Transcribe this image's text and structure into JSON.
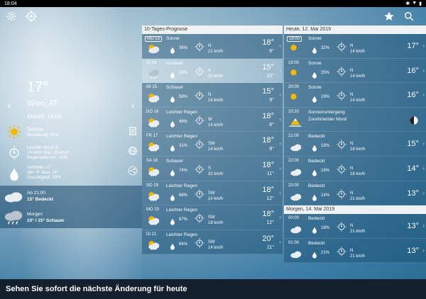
{
  "statusbar": {
    "time": "18:04"
  },
  "left": {
    "temperature": "17°",
    "city": "Wien, AT",
    "updated": "Aktuell: 18:04",
    "condition": {
      "title": "Sonne",
      "sub": "Bewölkung: 15%"
    },
    "wind": {
      "title": "Leichter Wind: N",
      "line1": "14 km/h Max: 23 km/h",
      "line2": "Regenwahrsch.: 32%"
    },
    "feels": {
      "line1": "Gefühlte: 17°",
      "line2": "Min: 9° Max: 18°",
      "line3": "Feuchtigkeit: 58%"
    },
    "forecast1": {
      "line1": "Ab 21:00",
      "line2": "15° Bedeckt"
    },
    "forecast2": {
      "line1": "Morgen",
      "line2": "10° / 15° Schauer"
    }
  },
  "mid": {
    "header": "10-Tages-Prognose",
    "days": [
      {
        "day": "MO 13",
        "desc": "Sonne",
        "pct": "36%",
        "dir": "N",
        "speed": "21 km/h",
        "hi": "18°",
        "lo": "9°",
        "icon": "sun-cloud",
        "boxed": true
      },
      {
        "day": "DI 14",
        "desc": "Schauer",
        "pct": "36%",
        "dir": "N",
        "speed": "25 km/h",
        "hi": "15°",
        "lo": "10°",
        "icon": "rain-cloud",
        "boxed": false
      },
      {
        "day": "MI 15",
        "desc": "Schauer",
        "pct": "58%",
        "dir": "N",
        "speed": "14 km/h",
        "hi": "15°",
        "lo": "9°",
        "icon": "sun-rain",
        "boxed": false
      },
      {
        "day": "DO 16",
        "desc": "Leichter Regen",
        "pct": "46%",
        "dir": "W",
        "speed": "14 km/h",
        "hi": "18°",
        "lo": "8°",
        "icon": "sun-rain",
        "boxed": false
      },
      {
        "day": "FR 17",
        "desc": "Leichter Regen",
        "pct": "31%",
        "dir": "SW",
        "speed": "14 km/h",
        "hi": "18°",
        "lo": "9°",
        "icon": "sun-rain",
        "boxed": false
      },
      {
        "day": "SA 18",
        "desc": "Schauer",
        "pct": "74%",
        "dir": "S",
        "speed": "32 km/h",
        "hi": "18°",
        "lo": "11°",
        "icon": "sun-rain",
        "boxed": false
      },
      {
        "day": "SO 19",
        "desc": "Leichter Regen",
        "pct": "68%",
        "dir": "SW",
        "speed": "14 km/h",
        "hi": "18°",
        "lo": "12°",
        "icon": "sun-rain",
        "boxed": false
      },
      {
        "day": "MO 20",
        "desc": "Leichter Regen",
        "pct": "67%",
        "dir": "SW",
        "speed": "18 km/h",
        "hi": "18°",
        "lo": "12°",
        "icon": "sun-rain",
        "boxed": false
      },
      {
        "day": "DI 21",
        "desc": "Leichter Regen",
        "pct": "64%",
        "dir": "SW",
        "speed": "14 km/h",
        "hi": "20°",
        "lo": "11°",
        "icon": "sun-rain",
        "boxed": false
      }
    ]
  },
  "right": {
    "header": "Heute, 12. Mai 2019",
    "header2": "Morgen, 14. Mai 2019",
    "hours": [
      {
        "time": "18:00",
        "desc": "Sonne",
        "pct": "32%",
        "dir": "N",
        "speed": "14 km/h",
        "temp": "17°",
        "icon": "sun",
        "boxed": true
      },
      {
        "time": "19:00",
        "desc": "Sonne",
        "pct": "25%",
        "dir": "N",
        "speed": "14 km/h",
        "temp": "16°",
        "icon": "sun",
        "boxed": false
      },
      {
        "time": "20:00",
        "desc": "Sonne",
        "pct": "19%",
        "dir": "N",
        "speed": "14 km/h",
        "temp": "16°",
        "icon": "sun",
        "boxed": false
      },
      {
        "time": "20:20",
        "desc": "Sonnenuntergang",
        "sub": "Zunehmender Mond",
        "sunset": true
      },
      {
        "time": "21:00",
        "desc": "Bedeckt",
        "pct": "18%",
        "dir": "N",
        "speed": "18 km/h",
        "temp": "15°",
        "icon": "cloud",
        "boxed": false
      },
      {
        "time": "22:00",
        "desc": "Bedeckt",
        "pct": "16%",
        "dir": "N",
        "speed": "18 km/h",
        "temp": "14°",
        "icon": "cloud",
        "boxed": false
      },
      {
        "time": "23:00",
        "desc": "Bedeckt",
        "pct": "14%",
        "dir": "N",
        "speed": "21 km/h",
        "temp": "13°",
        "icon": "cloud",
        "boxed": false
      }
    ],
    "hours2": [
      {
        "time": "00:00",
        "desc": "Bedeckt",
        "pct": "18%",
        "dir": "N",
        "speed": "21 km/h",
        "temp": "13°",
        "icon": "cloud",
        "boxed": false
      },
      {
        "time": "01:00",
        "desc": "Bedeckt",
        "pct": "21%",
        "dir": "N",
        "speed": "21 km/h",
        "temp": "13°",
        "icon": "cloud",
        "boxed": false
      }
    ]
  },
  "banner": {
    "text": "Sehen Sie sofort die nächste Änderung für heute"
  },
  "colors": {
    "sun": "#f5b800",
    "cloud": "#e8edf1",
    "banner": "#14202e"
  }
}
